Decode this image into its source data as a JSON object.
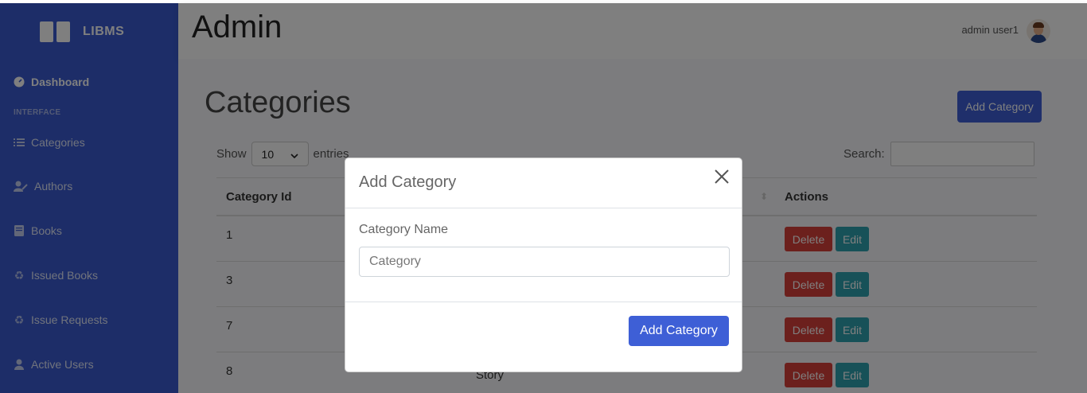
{
  "brand": {
    "name": "LIBMS"
  },
  "sidebar": {
    "dashboard": "Dashboard",
    "heading": "INTERFACE",
    "items": [
      {
        "label": "Categories",
        "icon": "list-icon"
      },
      {
        "label": "Authors",
        "icon": "user-pen-icon"
      },
      {
        "label": "Books",
        "icon": "book-icon"
      },
      {
        "label": "Issued Books",
        "icon": "recycle-icon"
      },
      {
        "label": "Issue Requests",
        "icon": "recycle-icon"
      },
      {
        "label": "Active Users",
        "icon": "user-icon"
      }
    ]
  },
  "topbar": {
    "title": "Admin",
    "user": "admin user1"
  },
  "main": {
    "title": "Categories",
    "add_button": "Add Category",
    "show_label": "Show",
    "entries_value": "10",
    "entries_label": "entries",
    "search_label": "Search:",
    "columns": [
      "Category Id",
      "Actions"
    ],
    "rows": [
      {
        "id": "1",
        "name": ""
      },
      {
        "id": "3",
        "name": ""
      },
      {
        "id": "7",
        "name": ""
      },
      {
        "id": "8",
        "name": "Story"
      }
    ],
    "delete_label": "Delete",
    "edit_label": "Edit"
  },
  "modal": {
    "title": "Add Category",
    "field_label": "Category Name",
    "field_placeholder": "Category",
    "submit_label": "Add Category"
  },
  "colors": {
    "sidebar": "#3a5bd1",
    "primary": "#3e5fd6",
    "danger": "#d9413a",
    "info": "#2fa2b0"
  }
}
